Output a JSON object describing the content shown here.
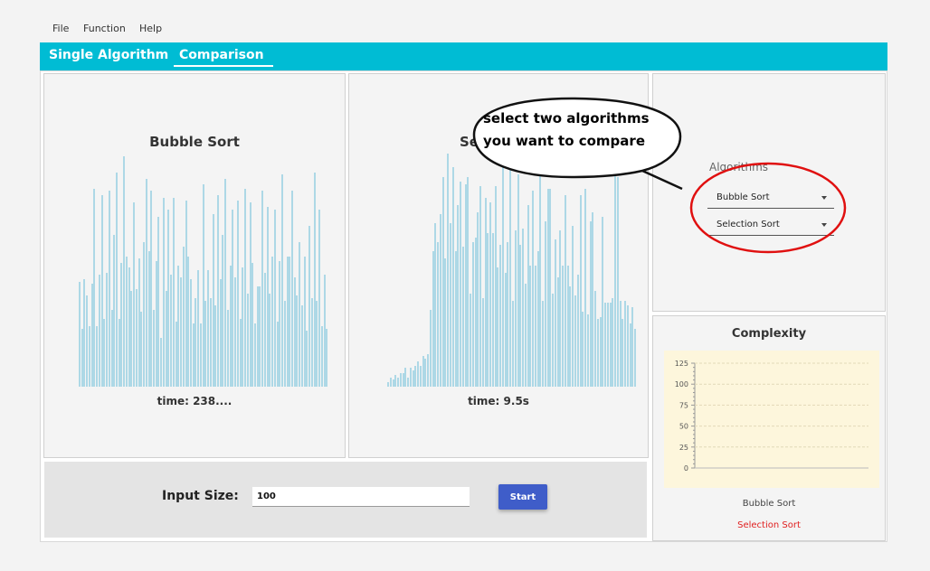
{
  "menu": [
    "File",
    "Function",
    "Help"
  ],
  "tabs": [
    {
      "label": "Single Algorithm"
    },
    {
      "label": "Comparison"
    }
  ],
  "left_panel": {
    "title": "Bubble Sort",
    "time": "time: 238....",
    "bars": [
      45,
      25,
      46,
      39,
      26,
      44,
      85,
      26,
      48,
      82,
      29,
      49,
      84,
      33,
      65,
      92,
      29,
      53,
      99,
      56,
      51,
      41,
      79,
      42,
      55,
      32,
      62,
      89,
      58,
      84,
      33,
      54,
      73,
      21,
      81,
      41,
      76,
      48,
      81,
      28,
      52,
      47,
      60,
      80,
      56,
      46,
      27,
      38,
      50,
      27,
      87,
      37,
      50,
      38,
      74,
      35,
      82,
      46,
      65,
      89,
      33,
      52,
      76,
      47,
      80,
      29,
      51,
      85,
      40,
      79,
      53,
      27,
      43,
      43,
      84,
      49,
      77,
      40,
      56,
      76,
      28,
      54,
      91,
      37,
      56,
      56,
      84,
      47,
      39,
      62,
      35,
      56,
      24,
      69,
      38,
      92,
      37,
      76,
      26,
      48,
      25
    ]
  },
  "mid_panel": {
    "title": "Selection Sort",
    "title_visible": "Sel",
    "time": "time: 9.5s",
    "bars": [
      2,
      4,
      3,
      5,
      4,
      6,
      6,
      8,
      4,
      8,
      7,
      9,
      11,
      9,
      13,
      12,
      14,
      33,
      58,
      70,
      62,
      74,
      90,
      55,
      100,
      70,
      94,
      58,
      78,
      88,
      60,
      87,
      90,
      40,
      62,
      64,
      75,
      86,
      38,
      81,
      66,
      79,
      66,
      86,
      51,
      61,
      94,
      49,
      62,
      95,
      37,
      67,
      91,
      61,
      68,
      44,
      78,
      52,
      84,
      52,
      58,
      91,
      37,
      71,
      85,
      85,
      40,
      63,
      47,
      67,
      52,
      82,
      52,
      43,
      69,
      39,
      48,
      82,
      32,
      85,
      31,
      71,
      75,
      41,
      29,
      30,
      73,
      36,
      36,
      36,
      38,
      91,
      90,
      37,
      29,
      37,
      35,
      27,
      34,
      25
    ]
  },
  "bottom": {
    "input_label": "Input Size:",
    "input_value": "100",
    "start_label": "Start"
  },
  "algorithms": {
    "label": "Algorithms",
    "select1": "Bubble Sort",
    "select2": "Selection Sort"
  },
  "complexity": {
    "title": "Complexity",
    "legend1": "Bubble Sort",
    "legend2": "Selection Sort",
    "legend2_color": "#e02020",
    "chart_data": {
      "type": "line",
      "title": "",
      "xlabel": "",
      "ylabel": "",
      "yticks": [
        0,
        25,
        50,
        75,
        100,
        125
      ],
      "ylim": [
        0,
        125
      ],
      "series": []
    }
  },
  "callout": {
    "line1": "select two algorithms",
    "line2": "you want to compare"
  }
}
